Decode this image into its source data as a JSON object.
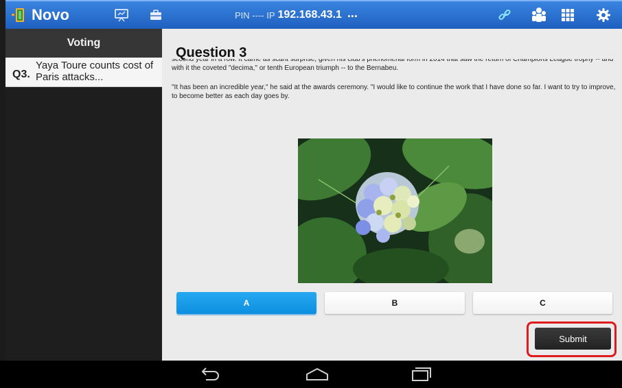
{
  "header": {
    "app_title": "Novo",
    "pin_label": "PIN ---- IP",
    "ip_value": "192.168.43.1",
    "more_dots": "...",
    "icons": [
      "app-logo-icon",
      "presentation-icon",
      "toolbox-icon",
      "link-icon",
      "users-icon",
      "grid-icon",
      "settings-icon"
    ]
  },
  "sidebar": {
    "title": "Voting",
    "items": [
      {
        "number": "Q3.",
        "title": "Yaya Toure counts cost of Paris attacks..."
      }
    ]
  },
  "main": {
    "question_title": "Question 3",
    "paragraph_1": "second year in a row. It came as scant surprise, given his club's phenomenal form in 2014 that saw the return of Champions League trophy -- and with it the coveted \"decima,\" or tenth European triumph -- to the Bernabeu.",
    "paragraph_2": "\"It has been an incredible year,\" he said at the awards ceremony. \"I would like to continue the work that I have done so far. I want to try to improve, to become better as each day goes by.",
    "image_subject": "blue hydrangea flower photo",
    "options": [
      {
        "label": "A",
        "selected": true
      },
      {
        "label": "B",
        "selected": false
      },
      {
        "label": "C",
        "selected": false
      }
    ],
    "submit_label": "Submit"
  },
  "navbar": {
    "icons": [
      "back-icon",
      "home-icon",
      "recent-apps-icon"
    ]
  },
  "colors": {
    "header_blue": "#2a6fd0",
    "selected_option": "#1a9be8",
    "highlight_red": "#e01a1a",
    "sidebar_dark": "#1e1e1e",
    "content_bg": "#ebebeb"
  }
}
